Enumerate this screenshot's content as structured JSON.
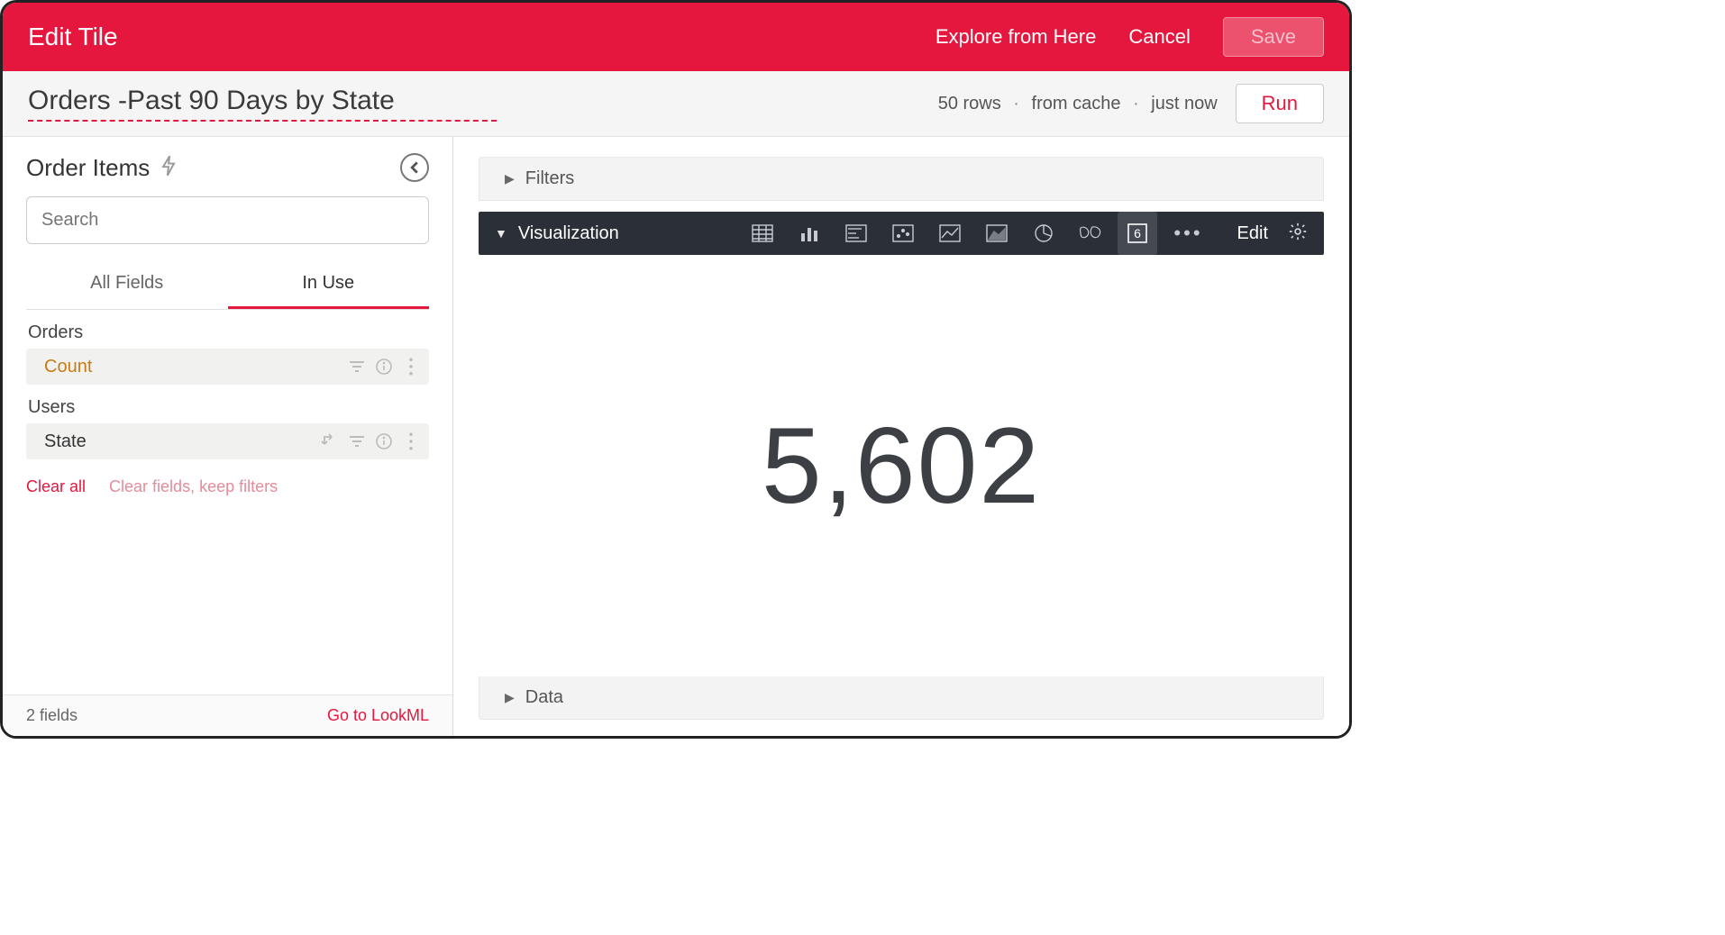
{
  "topbar": {
    "title": "Edit Tile",
    "explore": "Explore from Here",
    "cancel": "Cancel",
    "save": "Save"
  },
  "tile": {
    "name": "Orders -Past 90 Days by State"
  },
  "status": {
    "rows": "50 rows",
    "cache": "from cache",
    "time": "just now",
    "run": "Run"
  },
  "sidebar": {
    "explore_name": "Order Items",
    "search_placeholder": "Search",
    "tabs": {
      "all": "All Fields",
      "inuse": "In Use"
    },
    "groups": [
      {
        "label": "Orders",
        "fields": [
          {
            "name": "Count",
            "type": "measure",
            "pivot": false
          }
        ]
      },
      {
        "label": "Users",
        "fields": [
          {
            "name": "State",
            "type": "dimension",
            "pivot": true
          }
        ]
      }
    ],
    "clear_all": "Clear all",
    "clear_keep": "Clear fields, keep filters",
    "footer": {
      "count": "2 fields",
      "lookml": "Go to LookML"
    }
  },
  "panels": {
    "filters": "Filters",
    "visualization": "Visualization",
    "data": "Data",
    "edit": "Edit"
  },
  "viz": {
    "types": [
      "table",
      "column",
      "bar",
      "scatter",
      "line",
      "area",
      "pie",
      "map",
      "single_value"
    ],
    "active": "single_value",
    "value": "5,602",
    "single_value_glyph": "6"
  }
}
